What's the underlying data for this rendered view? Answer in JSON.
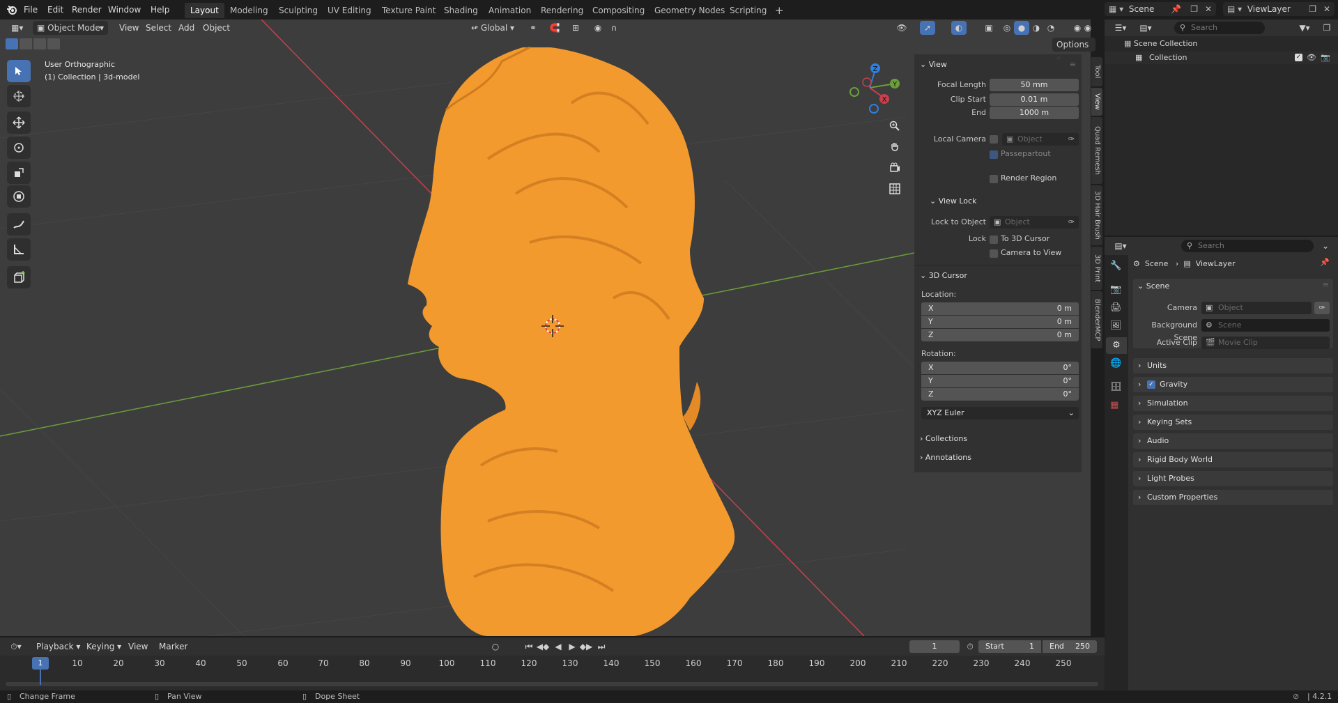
{
  "menu": [
    "File",
    "Edit",
    "Render",
    "Window",
    "Help"
  ],
  "workspaces": [
    "Layout",
    "Modeling",
    "Sculpting",
    "UV Editing",
    "Texture Paint",
    "Shading",
    "Animation",
    "Rendering",
    "Compositing",
    "Geometry Nodes",
    "Scripting"
  ],
  "active_workspace": "Layout",
  "scene_name": "Scene",
  "view_layer_name": "ViewLayer",
  "viewport_header": {
    "mode": "Object Mode",
    "menus": [
      "View",
      "Select",
      "Add",
      "Object"
    ],
    "orientation": "Global",
    "options": "Options"
  },
  "viewport_overlay": {
    "view_name": "User Orthographic",
    "collection_info": "(1) Collection | 3d-model"
  },
  "gizmo": {
    "z": "Z",
    "y": "Y",
    "x": "X"
  },
  "npanel": {
    "view_section": "View",
    "focal_length_label": "Focal Length",
    "focal_length": "50 mm",
    "clip_start_label": "Clip Start",
    "clip_start": "0.01 m",
    "end_label": "End",
    "clip_end": "1000 m",
    "local_camera_label": "Local Camera",
    "object_placeholder": "Object",
    "passepartout": "Passepartout",
    "render_region": "Render Region",
    "view_lock_section": "View Lock",
    "lock_to_object_label": "Lock to Object",
    "lock_label": "Lock",
    "to_3d_cursor": "To 3D Cursor",
    "camera_to_view": "Camera to View",
    "cursor_section": "3D Cursor",
    "location_label": "Location:",
    "rotation_label": "Rotation:",
    "loc": [
      {
        "axis": "X",
        "val": "0 m"
      },
      {
        "axis": "Y",
        "val": "0 m"
      },
      {
        "axis": "Z",
        "val": "0 m"
      }
    ],
    "rot": [
      {
        "axis": "X",
        "val": "0°"
      },
      {
        "axis": "Y",
        "val": "0°"
      },
      {
        "axis": "Z",
        "val": "0°"
      }
    ],
    "rotation_mode": "XYZ Euler",
    "collections": "Collections",
    "annotations": "Annotations"
  },
  "side_tabs": [
    "Tool",
    "View",
    "Quad Remesh",
    "3D Hair Brush",
    "3D Print",
    "BlenderMCP"
  ],
  "outliner": {
    "search_placeholder": "Search",
    "scene_collection": "Scene Collection",
    "collection": "Collection"
  },
  "properties": {
    "search_placeholder": "Search",
    "breadcrumb_scene": "Scene",
    "breadcrumb_viewlayer": "ViewLayer",
    "scene_section": "Scene",
    "camera_label": "Camera",
    "camera_placeholder": "Object",
    "bg_scene_label": "Background Scene",
    "bg_scene_placeholder": "Scene",
    "active_clip_label": "Active Clip",
    "active_clip_placeholder": "Movie Clip",
    "sections": [
      "Units",
      "Gravity",
      "Simulation",
      "Keying Sets",
      "Audio",
      "Rigid Body World",
      "Light Probes",
      "Custom Properties"
    ]
  },
  "timeline": {
    "menus": [
      "Playback",
      "Keying",
      "View",
      "Marker"
    ],
    "current_frame": "1",
    "start_label": "Start",
    "start": "1",
    "end_label": "End",
    "end": "250",
    "ticks": [
      "1",
      "10",
      "20",
      "30",
      "40",
      "50",
      "60",
      "70",
      "80",
      "90",
      "100",
      "110",
      "120",
      "130",
      "140",
      "150",
      "160",
      "170",
      "180",
      "190",
      "200",
      "210",
      "220",
      "230",
      "240",
      "250"
    ]
  },
  "statusbar": {
    "change_frame": "Change Frame",
    "pan_view": "Pan View",
    "dope_sheet": "Dope Sheet",
    "version": "4.2.1"
  },
  "colors": {
    "accent": "#4772b3",
    "model": "#f29a2e",
    "x_axis": "#c7404d",
    "y_axis": "#6b9f3a",
    "z_axis": "#2f7fe0"
  }
}
